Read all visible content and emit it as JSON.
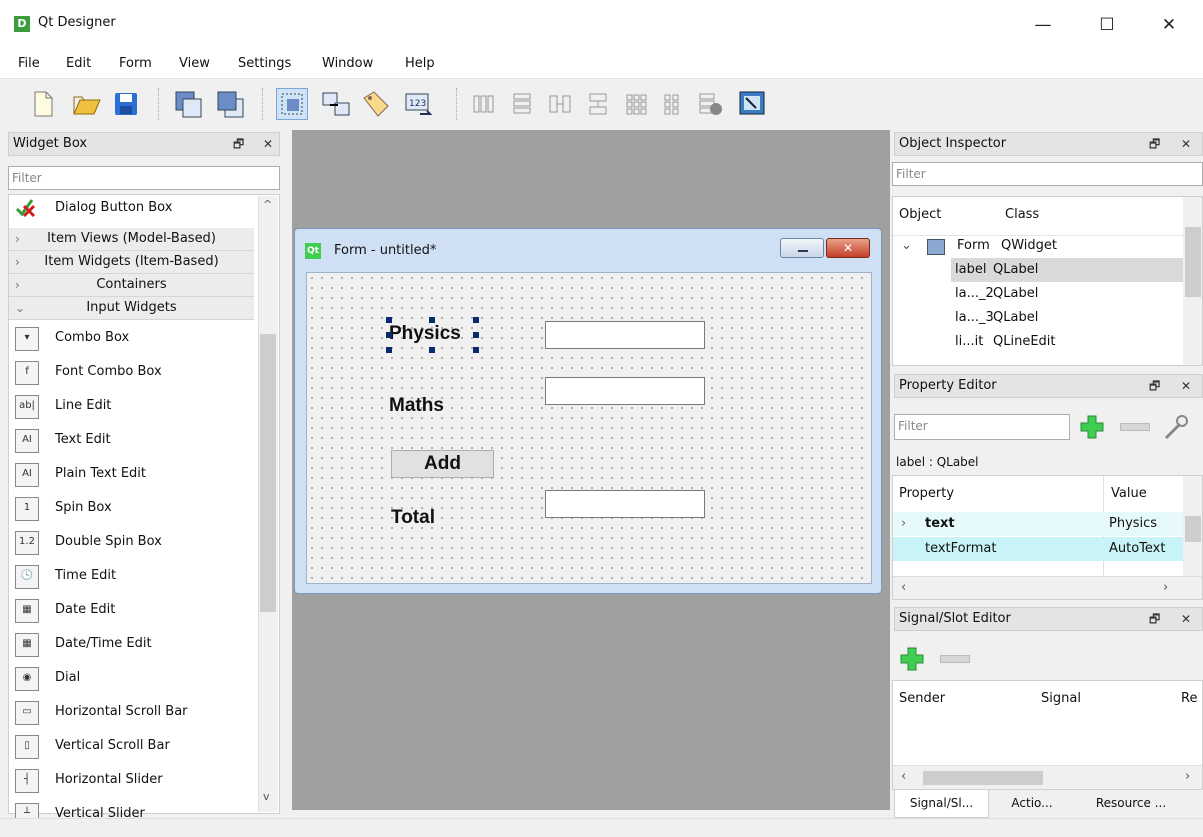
{
  "app": {
    "title": "Qt Designer",
    "icon_letter": "D"
  },
  "window_controls": {
    "minimize": "—",
    "maximize": "☐",
    "close": "✕"
  },
  "menu": [
    "File",
    "Edit",
    "Form",
    "View",
    "Settings",
    "Window",
    "Help"
  ],
  "toolbar_icons": [
    "new-form-icon",
    "open-form-icon",
    "save-form-icon",
    "send-to-back-icon",
    "bring-to-front-icon",
    "edit-widgets-icon",
    "edit-signals-slots-icon",
    "edit-buddies-icon",
    "edit-tab-order-icon",
    "layout-horizontal-icon",
    "layout-vertical-icon",
    "layout-splitter-horizontal-icon",
    "layout-splitter-vertical-icon",
    "layout-grid-icon",
    "layout-form-icon",
    "break-layout-icon",
    "adjust-size-icon"
  ],
  "widget_box": {
    "title": "Widget Box",
    "filter_placeholder": "Filter",
    "top_item": "Dialog Button Box",
    "categories": [
      "Item Views (Model-Based)",
      "Item Widgets (Item-Based)",
      "Containers",
      "Input Widgets"
    ],
    "items": [
      "Combo Box",
      "Font Combo Box",
      "Line Edit",
      "Text Edit",
      "Plain Text Edit",
      "Spin Box",
      "Double Spin Box",
      "Time Edit",
      "Date Edit",
      "Date/Time Edit",
      "Dial",
      "Horizontal Scroll Bar",
      "Vertical Scroll Bar",
      "Horizontal Slider",
      "Vertical Slider"
    ],
    "icon_glyphs": [
      "▾",
      "f",
      "ab|",
      "AI",
      "AI",
      "1",
      "1.2",
      "🕓",
      "▦",
      "▦",
      "◉",
      "▭",
      "▯",
      "┤",
      "┴"
    ]
  },
  "form": {
    "title": "Form - untitled*",
    "icon": "Qt",
    "labels": {
      "physics": "Physics",
      "maths": "Maths",
      "total": "Total"
    },
    "button": "Add"
  },
  "object_inspector": {
    "title": "Object Inspector",
    "filter_placeholder": "Filter",
    "headers": [
      "Object",
      "Class"
    ],
    "rows": [
      {
        "object": "Form",
        "class": "QWidget"
      },
      {
        "object": "label",
        "class": "QLabel"
      },
      {
        "object": "la..._2",
        "class": "QLabel"
      },
      {
        "object": "la..._3",
        "class": "QLabel"
      },
      {
        "object": "li...it",
        "class": "QLineEdit"
      }
    ]
  },
  "property_editor": {
    "title": "Property Editor",
    "filter_placeholder": "Filter",
    "context": "label : QLabel",
    "headers": [
      "Property",
      "Value"
    ],
    "rows": [
      {
        "property": "text",
        "value": "Physics"
      },
      {
        "property": "textFormat",
        "value": "AutoText"
      }
    ]
  },
  "signal_slot_editor": {
    "title": "Signal/Slot Editor",
    "headers": [
      "Sender",
      "Signal",
      "Re"
    ]
  },
  "bottom_tabs": [
    "Signal/Sl...",
    "Actio...",
    "Resource ..."
  ],
  "colors": {
    "selection": "#cce8ff",
    "highlight_row": "#d9d9d9",
    "canvas": "#a0a0a0",
    "qt_green": "#41cd52"
  }
}
